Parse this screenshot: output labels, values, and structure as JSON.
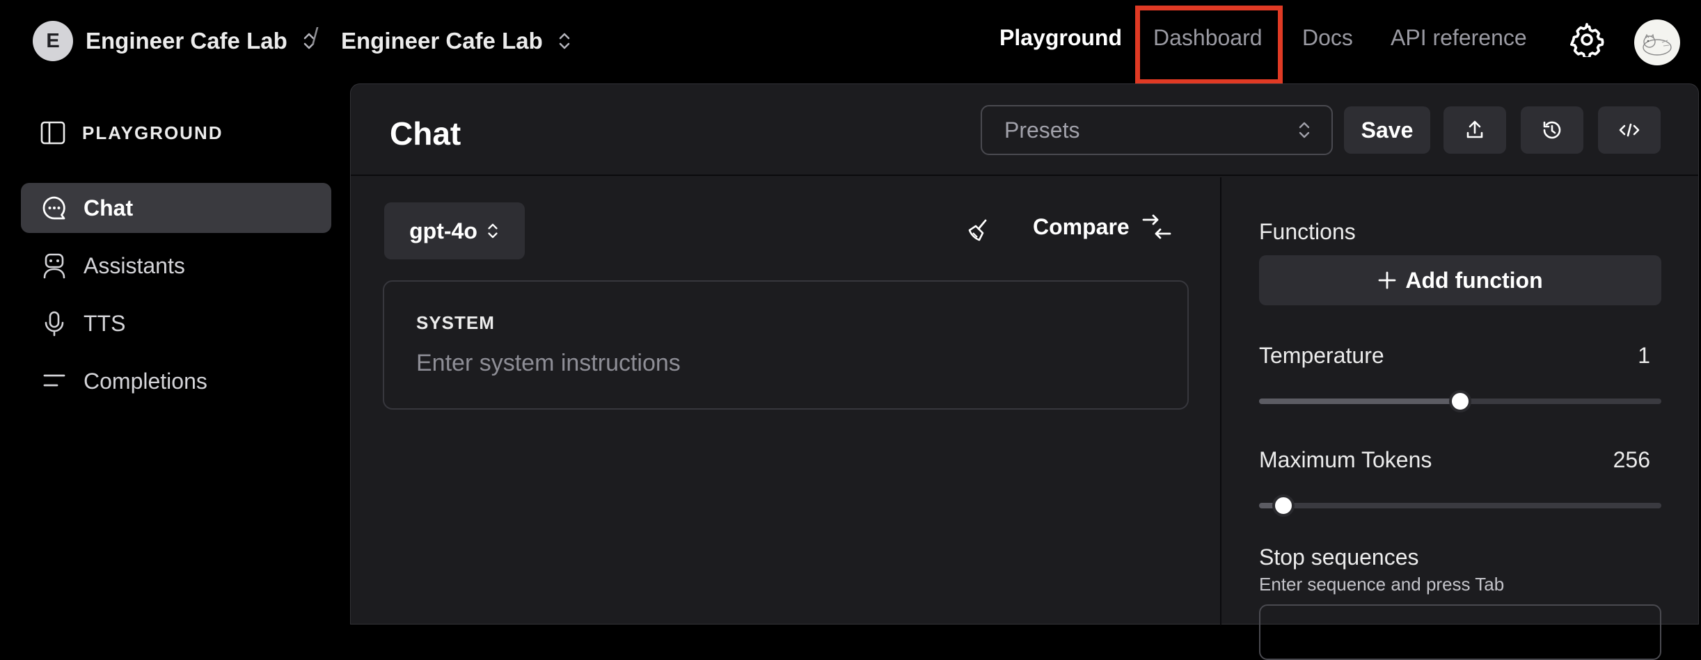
{
  "topbar": {
    "org_initial": "E",
    "org_name": "Engineer Cafe Lab",
    "separator": "/",
    "project_name": "Engineer Cafe Lab",
    "nav": {
      "playground": "Playground",
      "dashboard": "Dashboard",
      "docs": "Docs",
      "api_reference": "API reference"
    },
    "highlight_color": "#e03a24"
  },
  "sidebar": {
    "heading": "PLAYGROUND",
    "items": [
      {
        "label": "Chat",
        "icon": "chat-bubble-icon",
        "active": true
      },
      {
        "label": "Assistants",
        "icon": "robot-icon",
        "active": false
      },
      {
        "label": "TTS",
        "icon": "microphone-icon",
        "active": false
      },
      {
        "label": "Completions",
        "icon": "lines-icon",
        "active": false
      }
    ]
  },
  "main": {
    "title": "Chat",
    "presets_placeholder": "Presets",
    "save_label": "Save",
    "model": "gpt-4o",
    "compare_label": "Compare",
    "system": {
      "label": "SYSTEM",
      "placeholder": "Enter system instructions",
      "value": ""
    }
  },
  "settings": {
    "functions_label": "Functions",
    "add_function_label": "Add function",
    "temperature": {
      "label": "Temperature",
      "value": "1",
      "fraction": 0.5
    },
    "max_tokens": {
      "label": "Maximum Tokens",
      "value": "256",
      "fraction": 0.06
    },
    "stop_sequences": {
      "label": "Stop sequences",
      "hint": "Enter sequence and press Tab"
    }
  },
  "colors": {
    "background": "#000000",
    "panel": "#1c1c1f",
    "active_item": "#3a3a3f",
    "button": "#2e2e33"
  }
}
